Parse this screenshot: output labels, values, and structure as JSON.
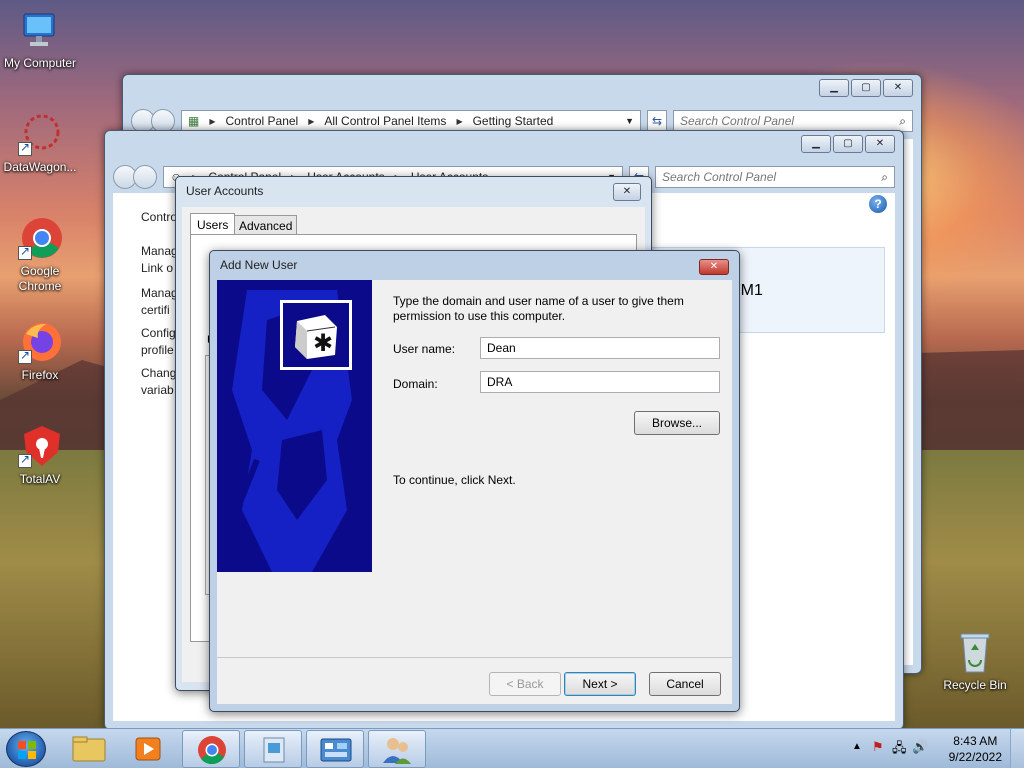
{
  "desktop": {
    "icons": [
      {
        "label": "My Computer"
      },
      {
        "label": "DataWagon..."
      },
      {
        "label": "Google Chrome"
      },
      {
        "label": "Firefox"
      },
      {
        "label": "TotalAV"
      },
      {
        "label": "Recycle Bin"
      }
    ]
  },
  "back_window": {
    "breadcrumb": [
      "Control Panel",
      "All Control Panel Items",
      "Getting Started"
    ],
    "search_placeholder": "Search Control Panel"
  },
  "mid_window": {
    "breadcrumb": [
      "Control Panel",
      "User Accounts",
      "User Accounts"
    ],
    "search_placeholder": "Search Control Panel",
    "help_glyph": "?",
    "sidebar_fragments": [
      "Contro",
      "Manag",
      "Link o",
      "Manag",
      "certifi",
      "Config",
      "profile",
      "Chang",
      "variab"
    ],
    "right_fragment": "YM1"
  },
  "user_accounts_dialog": {
    "title": "User Accounts",
    "tabs": [
      "Users",
      "Advanced"
    ],
    "partial_label": "U"
  },
  "add_user_dialog": {
    "title": "Add New User",
    "instruction": "Type the domain and user name of a user to give them permission to use this computer.",
    "username_label": "User name:",
    "username_value": "Dean",
    "domain_label": "Domain:",
    "domain_value": "DRA",
    "browse_label": "Browse...",
    "continue_text": "To continue, click Next.",
    "back_label": "< Back",
    "next_label": "Next >",
    "cancel_label": "Cancel"
  },
  "taskbar": {
    "time": "8:43 AM",
    "date": "9/22/2022"
  },
  "colors": {
    "accent": "#3c7fb1",
    "close_red": "#c0392b",
    "banner_blue": "#0a0a8a"
  }
}
